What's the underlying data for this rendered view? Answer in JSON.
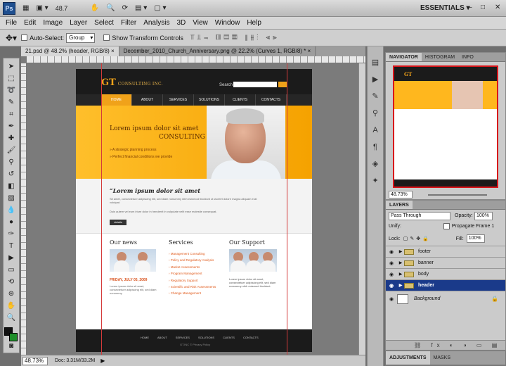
{
  "app": {
    "logo": "Ps",
    "zoom_value": "48.7",
    "workspace": "ESSENTIALS",
    "workspace_arrow": "▾",
    "cs_live": "CS Live",
    "window_controls": [
      "–",
      "□",
      "✕"
    ]
  },
  "menu": [
    "File",
    "Edit",
    "Image",
    "Layer",
    "Select",
    "Filter",
    "Analysis",
    "3D",
    "View",
    "Window",
    "Help"
  ],
  "options": {
    "auto_select_label": "Auto-Select:",
    "auto_select_value": "Group",
    "transform_label": "Show Transform Controls"
  },
  "doc_tabs": [
    {
      "label": "21.psd @ 48.2% (header, RGB/8)",
      "close": "×"
    },
    {
      "label": "December_2010_Church_Anniversary.png @ 22.2% (Curves 1, RGB/8) *",
      "close": "×"
    }
  ],
  "site": {
    "logo_gt": "GT",
    "logo_sub": "CONSULTING INC.",
    "search_label": "Search",
    "nav": [
      "HOME",
      "ABOUT",
      "SERVICES",
      "SOLUTIONS",
      "CLIENTS",
      "CONTACTS"
    ],
    "banner_line1": "Lorem ipsum dolor sit amet",
    "banner_line2": "CONSULTING",
    "banner_b1": "A strategic planning process",
    "banner_b2": "Perfect financial conditions we provide",
    "intro_title": "“Lorem ipsum dolor sit amet",
    "intro_p1": "Sit amet, consectetuer adipiscing elit, sed diam nonummy nibh euismod tincidunt ut laoreet dolore magna aliquam erat volutpat.",
    "intro_p2": "Duis autem vel eum iriure dolor in hendrerit in vulputate velit esse molestie consequat.",
    "more_label": "details",
    "col1": "Our news",
    "col2": "Services",
    "col3": "Our Support",
    "news_date": "FRIDAY, JULY 05, 2009",
    "news_text": "Lorem ipsum dolor sit amet, consectetuer adipiscing elit, sed diam nonummy.",
    "services": [
      "Management Consulting",
      "Policy and Regulatory Analysis",
      "Market Assessments",
      "Program Management",
      "Regulatory Support",
      "Scientific and Risk Assessments",
      "Change Management"
    ],
    "support_text": "Lorem ipsum dolor sit amet, consectetuer adipiscing elit, sed diam nonummy nibh euismod tincidunt.",
    "footer_links": [
      "HOME",
      "ABOUT",
      "SERVICES",
      "SOLUTIONS",
      "CLIENTS",
      "CONTACTS"
    ],
    "copyright": "GT.INC © Privacy Policy"
  },
  "status": {
    "zoom": "48.73%",
    "doc": "Doc: 3.31M/33.2M"
  },
  "navigator": {
    "tabs": [
      "NAVIGATOR",
      "HISTOGRAM",
      "INFO"
    ],
    "zoom": "48.73%"
  },
  "layers": {
    "tabs": [
      "LAYERS"
    ],
    "blend_mode": "Pass Through",
    "opacity_label": "Opacity:",
    "opacity_value": "100%",
    "unify_label": "Unify:",
    "propagate_label": "Propagate Frame 1",
    "lock_label": "Lock:",
    "fill_label": "Fill:",
    "fill_value": "100%",
    "items": [
      "footer",
      "banner",
      "body",
      "header",
      "Background"
    ]
  },
  "bottom_tabs": [
    "ADJUSTMENTS",
    "MASKS"
  ]
}
